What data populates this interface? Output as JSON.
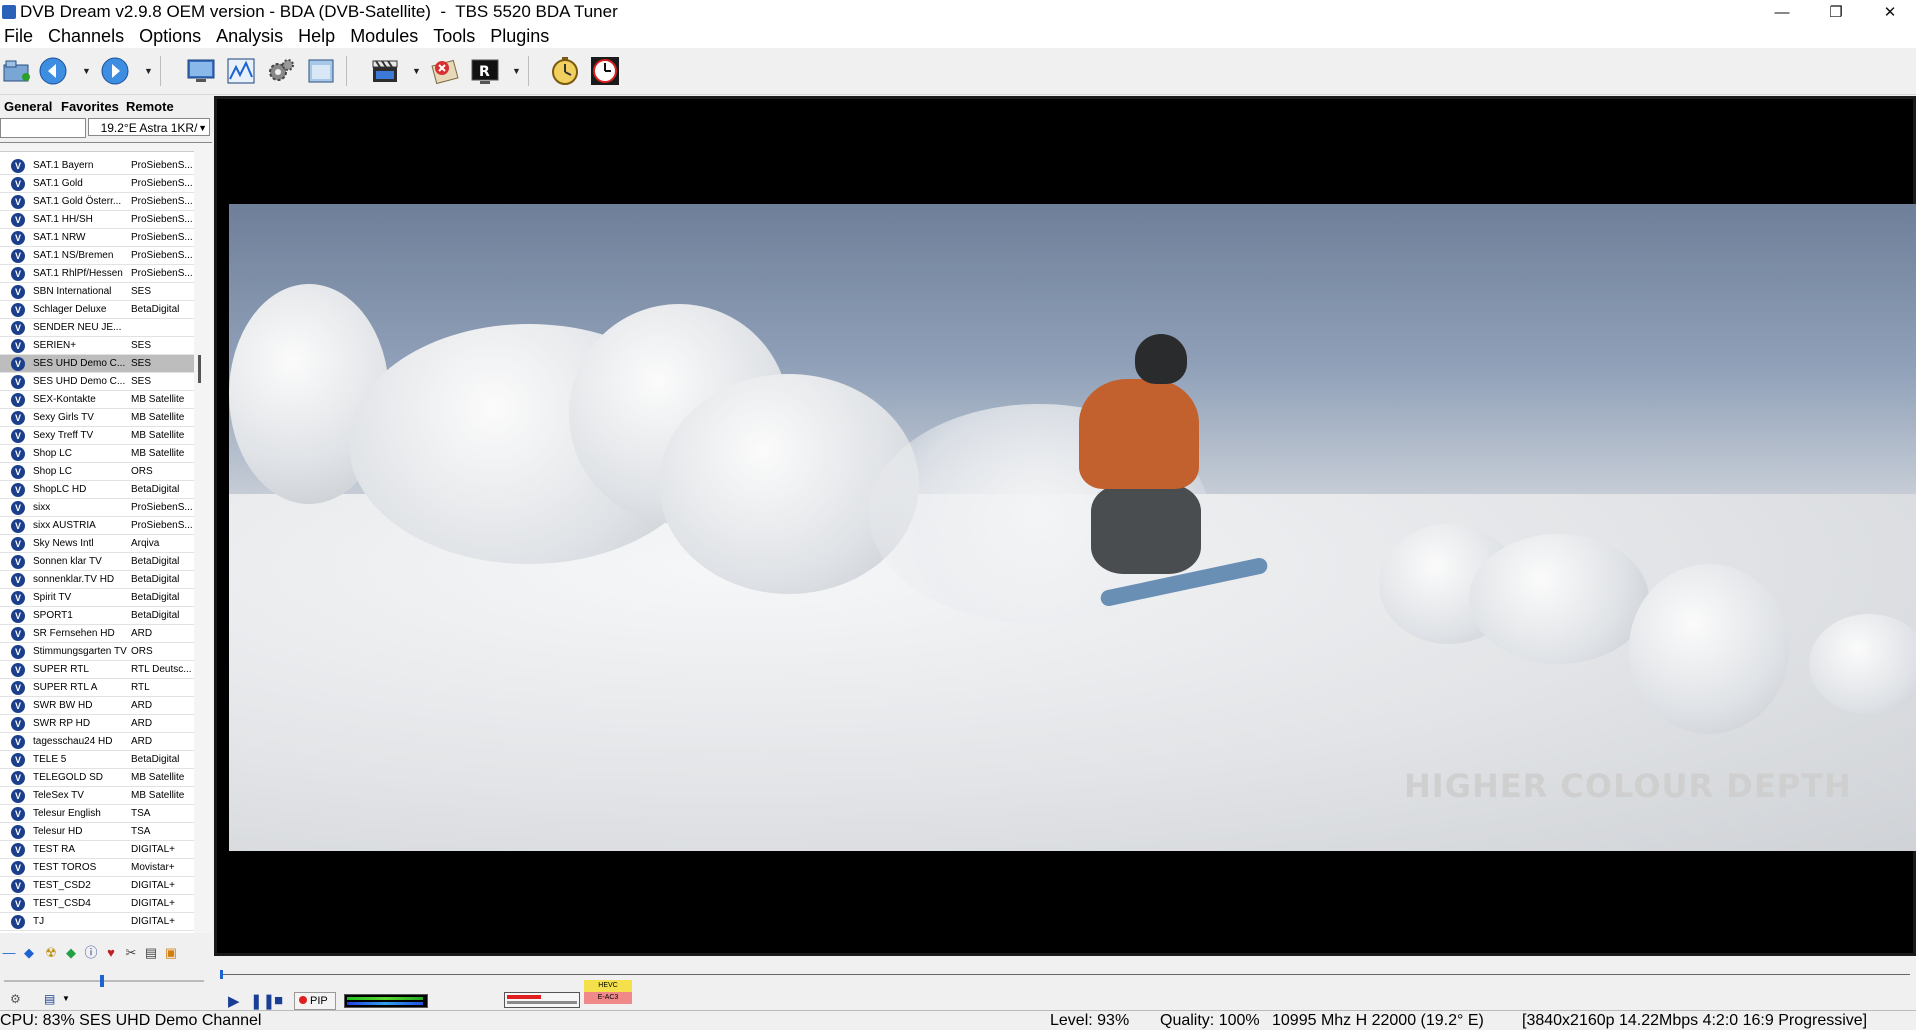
{
  "window": {
    "title": "DVB Dream v2.9.8 OEM version - BDA (DVB-Satellite)  -  TBS 5520 BDA Tuner",
    "minimize": "—",
    "restore": "❐",
    "close": "✕"
  },
  "menu": [
    "File",
    "Channels",
    "Options",
    "Analysis",
    "Help",
    "Modules",
    "Tools",
    "Plugins"
  ],
  "tabs": [
    "General",
    "Favorites",
    "Remote"
  ],
  "satellite": {
    "selected": "19.2°E Astra 1KR/"
  },
  "channels": [
    {
      "name": "SAT.1 Bayern",
      "provider": "ProSiebenS..."
    },
    {
      "name": "SAT.1 Gold",
      "provider": "ProSiebenS..."
    },
    {
      "name": "SAT.1 Gold Österr...",
      "provider": "ProSiebenS..."
    },
    {
      "name": "SAT.1 HH/SH",
      "provider": "ProSiebenS..."
    },
    {
      "name": "SAT.1 NRW",
      "provider": "ProSiebenS..."
    },
    {
      "name": "SAT.1 NS/Bremen",
      "provider": "ProSiebenS..."
    },
    {
      "name": "SAT.1 RhlPf/Hessen",
      "provider": "ProSiebenS..."
    },
    {
      "name": "SBN International",
      "provider": "SES"
    },
    {
      "name": "Schlager Deluxe",
      "provider": "BetaDigital"
    },
    {
      "name": "SENDER NEU JE...",
      "provider": ""
    },
    {
      "name": "SERIEN+",
      "provider": "SES"
    },
    {
      "name": "SES UHD Demo C...",
      "provider": "SES",
      "selected": true
    },
    {
      "name": "SES UHD Demo C...",
      "provider": "SES"
    },
    {
      "name": "SEX-Kontakte",
      "provider": "MB Satellite"
    },
    {
      "name": "Sexy Girls TV",
      "provider": "MB Satellite"
    },
    {
      "name": "Sexy Treff TV",
      "provider": "MB Satellite"
    },
    {
      "name": "Shop LC",
      "provider": "MB Satellite"
    },
    {
      "name": "Shop LC",
      "provider": "ORS"
    },
    {
      "name": "ShopLC HD",
      "provider": "BetaDigital"
    },
    {
      "name": "sixx",
      "provider": "ProSiebenS..."
    },
    {
      "name": "sixx AUSTRIA",
      "provider": "ProSiebenS..."
    },
    {
      "name": "Sky News Intl",
      "provider": "Arqiva"
    },
    {
      "name": "Sonnen klar TV",
      "provider": "BetaDigital"
    },
    {
      "name": "sonnenklar.TV HD",
      "provider": "BetaDigital"
    },
    {
      "name": "Spirit TV",
      "provider": "BetaDigital"
    },
    {
      "name": "SPORT1",
      "provider": "BetaDigital"
    },
    {
      "name": "SR Fernsehen HD",
      "provider": "ARD"
    },
    {
      "name": "Stimmungsgarten TV",
      "provider": "ORS"
    },
    {
      "name": "SUPER RTL",
      "provider": "RTL Deutsc..."
    },
    {
      "name": "SUPER RTL A",
      "provider": "RTL"
    },
    {
      "name": "SWR BW HD",
      "provider": "ARD"
    },
    {
      "name": "SWR RP HD",
      "provider": "ARD"
    },
    {
      "name": "tagesschau24 HD",
      "provider": "ARD"
    },
    {
      "name": "TELE 5",
      "provider": "BetaDigital"
    },
    {
      "name": "TELEGOLD SD",
      "provider": "MB Satellite"
    },
    {
      "name": "TeleSex TV",
      "provider": "MB Satellite"
    },
    {
      "name": "Telesur English",
      "provider": "TSA"
    },
    {
      "name": "Telesur HD",
      "provider": "TSA"
    },
    {
      "name": "TEST RA",
      "provider": "DIGITAL+"
    },
    {
      "name": "TEST TOROS",
      "provider": "Movistar+"
    },
    {
      "name": "TEST_CSD2",
      "provider": "DIGITAL+"
    },
    {
      "name": "TEST_CSD4",
      "provider": "DIGITAL+"
    },
    {
      "name": "TJ",
      "provider": "DIGITAL+"
    }
  ],
  "video": {
    "overlay_text": "HIGHER COLOUR DEPTH"
  },
  "player": {
    "pip_label": "PIP",
    "codec_video": "HEVC",
    "codec_audio": "E-AC3"
  },
  "status": {
    "cpu": "CPU: 83% SES UHD Demo Channel",
    "level": "Level: 93%",
    "quality": "Quality: 100%",
    "tuning": "10995 Mhz  H  22000  (19.2° E)",
    "stream": "[3840x2160p  14.22Mbps 4:2:0  16:9 Progressive]"
  },
  "colors": {
    "channel_icon": "#1c3f8c",
    "accent_blue": "#1c63d4",
    "selected_row": "#bdbdbd"
  }
}
